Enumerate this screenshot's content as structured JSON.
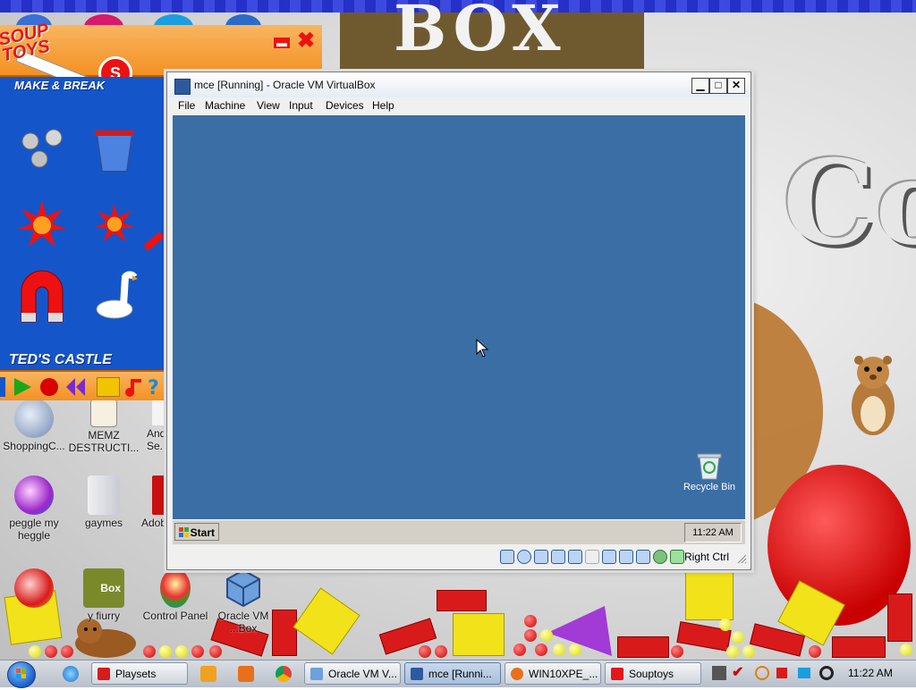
{
  "background": {
    "logo_text": "BOX",
    "side_text": "Co"
  },
  "souptoys": {
    "logo": "SOUP\nTOYS",
    "badge": "S",
    "minimize_glyph": "▬",
    "close_glyph": "✖",
    "section_top": "MAKE & BREAK",
    "section_bottom": "TED'S CASTLE"
  },
  "desktop_icons": [
    {
      "label": "ShoppingC..."
    },
    {
      "label": "MEMZ DESTRUCTI..."
    },
    {
      "label": "And... Se..."
    },
    {
      "label": "peggle my heggle"
    },
    {
      "label": "gaymes"
    },
    {
      "label": "Adob..."
    },
    {
      "label": "Box"
    },
    {
      "label": "y fiurry"
    },
    {
      "label": "Control Panel"
    },
    {
      "label": "Oracle VM ...Box"
    }
  ],
  "vbox": {
    "title": "mce [Running] - Oracle VM VirtualBox",
    "menu": [
      "File",
      "Machine",
      "View",
      "Input",
      "Devices",
      "Help"
    ],
    "guest": {
      "recycle_bin": "Recycle Bin",
      "start": "Start",
      "clock": "11:22 AM"
    },
    "host_key": "Right Ctrl"
  },
  "taskbar": {
    "buttons": [
      "Playsets",
      "Oracle VM V...",
      "mce [Runni...",
      "WIN10XPE_...",
      "Souptoys"
    ],
    "active_index": 2,
    "clock": "11:22 AM"
  },
  "colors": {
    "guest_desktop": "#3a6ea5",
    "souptoys_orange": "#f39122",
    "souptoys_blue": "#1456c9",
    "accent_red": "#e3171c"
  }
}
